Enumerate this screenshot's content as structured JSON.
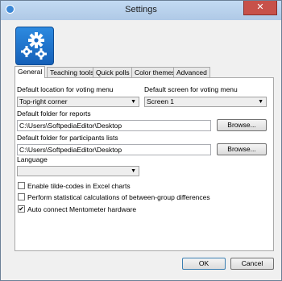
{
  "window": {
    "title": "Settings",
    "close_glyph": "✕"
  },
  "tabs": [
    {
      "label": "General",
      "active": true
    },
    {
      "label": "Teaching tools"
    },
    {
      "label": "Quick polls"
    },
    {
      "label": "Color themes"
    },
    {
      "label": "Advanced"
    }
  ],
  "general": {
    "voting_menu_location": {
      "label": "Default location for voting menu",
      "value": "Top-right corner"
    },
    "voting_menu_screen": {
      "label": "Default screen for voting menu",
      "value": "Screen 1"
    },
    "reports_folder": {
      "label": "Default folder for reports",
      "value": "C:\\Users\\SoftpediaEditor\\Desktop",
      "browse_label": "Browse..."
    },
    "participants_folder": {
      "label": "Default folder for participants lists",
      "value": "C:\\Users\\SoftpediaEditor\\Desktop",
      "browse_label": "Browse..."
    },
    "language": {
      "label": "Language",
      "value": ""
    },
    "checkboxes": [
      {
        "label": "Enable tilde-codes in Excel charts",
        "checked": false
      },
      {
        "label": "Perform statistical calculations of between-group differences",
        "checked": false
      },
      {
        "label": "Auto connect Mentometer hardware",
        "checked": true
      }
    ]
  },
  "footer": {
    "ok_label": "OK",
    "cancel_label": "Cancel"
  },
  "icons": {
    "dropdown_arrow": "▼",
    "check_mark": "✔"
  },
  "colors": {
    "title_bar": "#b7cfe9",
    "close_button": "#c7514a",
    "logo": "#1f74cd"
  }
}
